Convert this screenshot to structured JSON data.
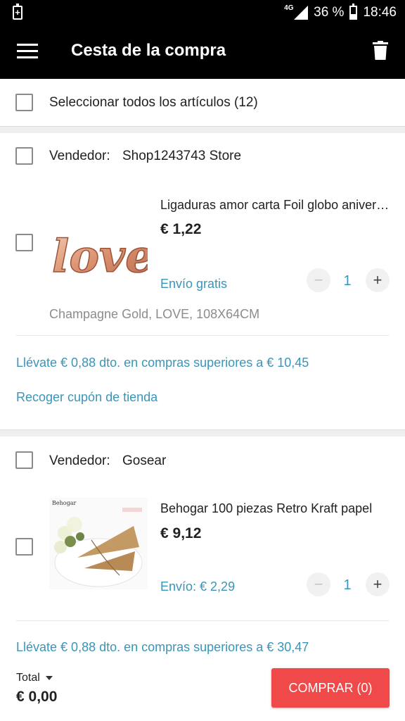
{
  "status_bar": {
    "network": "4G",
    "battery": "36 %",
    "battery_level": 0.36,
    "time": "18:46"
  },
  "app_bar": {
    "title": "Cesta de la compra"
  },
  "select_all": {
    "label": "Seleccionar todos los artículos (12)"
  },
  "stores": [
    {
      "seller_label": "Vendedor:",
      "seller_name": "Shop1243743 Store",
      "item": {
        "title": "Ligaduras amor carta Foil globo aniversario",
        "image_text": "love",
        "price": "€ 1,22",
        "shipping": "Envío gratis",
        "quantity": "1",
        "variant": "Champagne Gold, LOVE, 108X64CM"
      },
      "promo": "Llévate € 0,88 dto. en compras superiores a € 10,45",
      "coupon": "Recoger cupón de tienda"
    },
    {
      "seller_label": "Vendedor:",
      "seller_name": "Gosear",
      "item": {
        "title": "Behogar 100 piezas Retro Kraft papel",
        "image_text": "Behogar",
        "price": "€ 9,12",
        "shipping": "Envío: € 2,29",
        "quantity": "1"
      },
      "promo": "Llévate € 0,88 dto. en compras superiores a € 30,47"
    }
  ],
  "stepper": {
    "minus": "−",
    "plus": "+"
  },
  "footer": {
    "total_label": "Total",
    "total_value": "€ 0,00",
    "buy_label": "COMPRAR (0)"
  },
  "colors": {
    "accent_blue": "#3a95b8",
    "buy_red": "#f0494a",
    "header": "#000000"
  }
}
